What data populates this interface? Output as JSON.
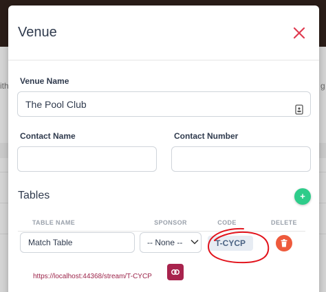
{
  "background": {
    "left_text": "ith",
    "right_text": "g"
  },
  "modal": {
    "title": "Venue",
    "close_icon": "close-icon",
    "venue_name": {
      "label": "Venue Name",
      "value": "The Pool Club"
    },
    "contact_name": {
      "label": "Contact Name",
      "value": ""
    },
    "contact_number": {
      "label": "Contact Number",
      "value": ""
    },
    "tables": {
      "title": "Tables",
      "add_icon": "plus-icon",
      "columns": [
        "TABLE NAME",
        "SPONSOR",
        "CODE",
        "DELETE"
      ],
      "rows": [
        {
          "table_name": "Match Table",
          "sponsor": "-- None --",
          "code": "T-CYCP",
          "stream_url": "https://localhost:44368/stream/T-CYCP"
        }
      ]
    }
  },
  "colors": {
    "title": "#2f3a4d",
    "close": "#e03b50",
    "add": "#2ecc8a",
    "delete": "#ee5a3c",
    "link": "#a8234d",
    "annotation": "#e2131c",
    "code_badge": "#e7ecf3"
  }
}
